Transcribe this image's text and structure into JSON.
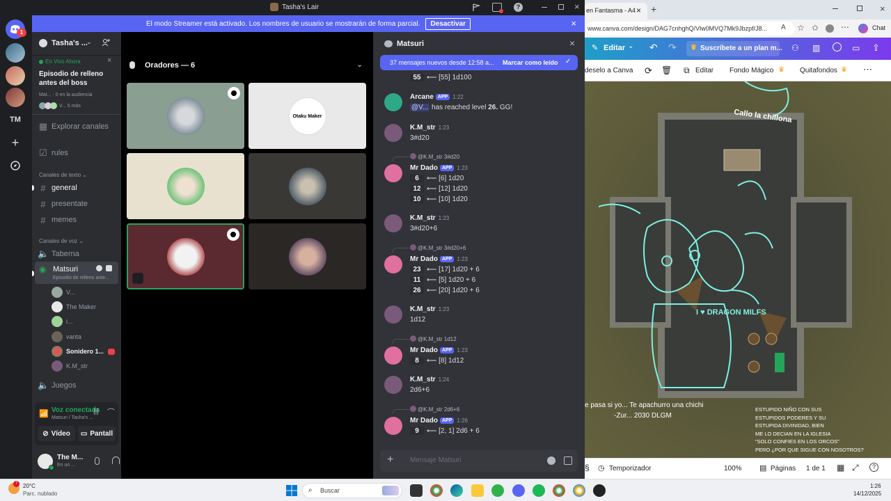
{
  "discord": {
    "window_title": "Tasha's Lair",
    "streamer_notice": "El modo Streamer está activado. Los nombres de usuario se mostrarán de forma parcial.",
    "streamer_button": "Desactivar",
    "server_badge": "1",
    "server_initials": "TM",
    "server_name": "Tasha's ...",
    "live_label": "En Vivo Ahora",
    "event_title": "Episodio de relleno antes del boss",
    "event_meta": "Mat...",
    "event_audience": "0 en la audiencia",
    "event_participants": "V... 5 más",
    "explore_channels": "Explorar canales",
    "rules_channel": "rules",
    "text_channels_header": "Canales de texto",
    "text_channels": [
      "general",
      "presentate",
      "memes"
    ],
    "voice_channels_header": "Canales de voz",
    "voice_channels": [
      "Taberna",
      "Matsuri",
      "Juegos"
    ],
    "matsuri_subtitle": "Episodio de relleno ante...",
    "voice_users": [
      "V...",
      "The Maker",
      "i...",
      "vanta",
      "Sonidero 1...",
      "K.M_str"
    ],
    "voice_connected": "Voz conectada",
    "voice_location": "Matsuri / Tasha's ...",
    "video_button": "Vídeo",
    "screen_button": "Pantall",
    "user_name": "The M...",
    "user_status": "En un ...",
    "speakers_header": "Oradores — 6",
    "tile_logo_text": "Otaku Maker",
    "chat_channel": "Matsuri",
    "new_messages": "37 mensajes nuevos desde 12:58 a...",
    "mark_read": "Marcar como leído",
    "app_badge": "APP",
    "chat_placeholder": "Mensaje Matsuri",
    "top_roll": {
      "result": "55",
      "detail": "⟵ [55] 1d100"
    },
    "arcane": {
      "name": "Arcane",
      "time": "1:22",
      "mention": "@V...",
      "text_pre": "has reached level",
      "level": "26.",
      "text_post": "GG!"
    },
    "messages": [
      {
        "name": "K.M_str",
        "time": "1:23",
        "text": "3#d20"
      },
      {
        "reply": "@K.M_str 3#d20",
        "name": "Mr Dado",
        "time": "1:23",
        "rolls": [
          [
            "6",
            "⟵ [6] 1d20"
          ],
          [
            "12",
            "⟵ [12] 1d20"
          ],
          [
            "10",
            "⟵ [10] 1d20"
          ]
        ]
      },
      {
        "name": "K.M_str",
        "time": "1:23",
        "text": "3#d20+6"
      },
      {
        "reply": "@K.M_str 3#d20+6",
        "name": "Mr Dado",
        "time": "1:23",
        "rolls": [
          [
            "23",
            "⟵ [17] 1d20 + 6"
          ],
          [
            "11",
            "⟵ [5] 1d20 + 6"
          ],
          [
            "26",
            "⟵ [20] 1d20 + 6"
          ]
        ]
      },
      {
        "name": "K.M_str",
        "time": "1:23",
        "text": "1d12"
      },
      {
        "reply": "@K.M_str 1d12",
        "name": "Mr Dado",
        "time": "1:23",
        "rolls": [
          [
            "8",
            "⟵ [8] 1d12"
          ]
        ]
      },
      {
        "name": "K.M_str",
        "time": "1:24",
        "text": "2d6+6"
      },
      {
        "reply": "@K.M_str 2d6+6",
        "name": "Mr Dado",
        "time": "1:26",
        "rolls": [
          [
            "9",
            "⟵ [2, 1] 2d6 + 6"
          ]
        ]
      }
    ]
  },
  "browser": {
    "tab_title": "en Fantasma - A4",
    "url": "www.canva.com/design/DAG7cnhghQ/Vlw0MVQ7Mk9Jbzpf/J8...",
    "chat_label": "Chat",
    "edit_button": "Editar",
    "subscribe_text": "Suscríbete a un plan m...",
    "toolbar_items": [
      "deselo a Canva",
      "Editar",
      "Fondo Mágico",
      "Quitafondos"
    ],
    "map_label_top": "Callo la chillona",
    "doodle_text": "I ♥ DRAGON MILFS",
    "quote_line1": "e pasa si yo... Te apachurro una chichi",
    "quote_line2": "-Zur... 2030 DLGM",
    "side_text": [
      "ESTUPIDO NIÑO CON SUS",
      "ESTUPIDOS PODERES Y SU",
      "ESTUPIDA DIVINIDAD, BIEN",
      "ME LO DECIAN EN LA IGLESIA",
      "\"SOLO CONFIES EN LOS ORCOS\"",
      "PERO ¿POR QUE SIGUE CON NOSOTROS?"
    ],
    "timer_label": "Temporizador",
    "zoom": "100%",
    "pages_label": "Páginas",
    "page_count": "1 de 1"
  },
  "taskbar": {
    "weather_temp": "20°C",
    "weather_desc": "Parc. nublado",
    "search_placeholder": "Buscar",
    "time": "1:26",
    "date": "14/12/2025"
  }
}
